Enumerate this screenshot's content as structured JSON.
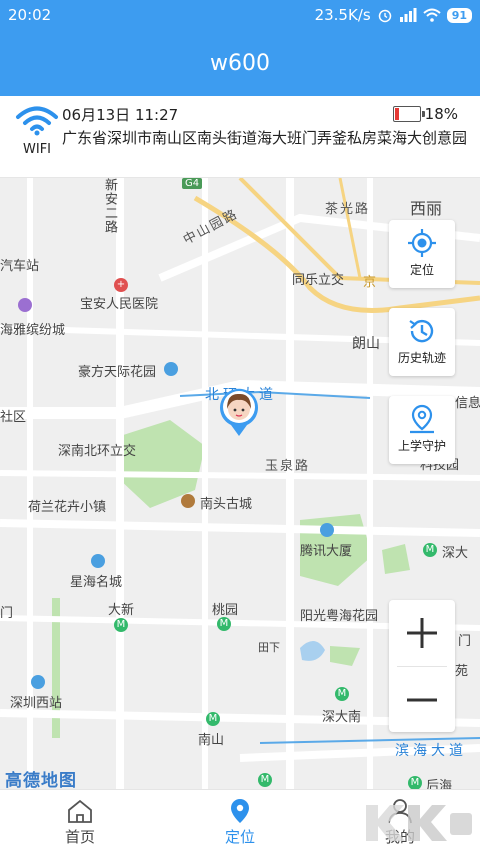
{
  "status_bar": {
    "time": "20:02",
    "net_speed": "23.5K/s",
    "battery_level": "91"
  },
  "header": {
    "title": "w600"
  },
  "device_info": {
    "connection_label": "WIFI",
    "timestamp": "06月13日 11:27",
    "battery_percent": "18%",
    "battery_fraction": 0.18,
    "address": "广东省深圳市南山区南头街道海大班门弄釜私房菜海大创意园"
  },
  "map": {
    "labels": {
      "xin_an_road": "新安二路",
      "car_station": "汽车站",
      "baoan_hospital": "宝安人民医院",
      "yafang": "海雅缤纷城",
      "haofang": "豪方天际花园",
      "she_qu": "社区",
      "shennan_beihuan": "深南北环立交",
      "helan": "荷兰花卉小镇",
      "xinghai": "星海名城",
      "men1": "门",
      "daxin": "大新",
      "shenzhen_west": "深圳西站",
      "zhongshan_park_road": "中山园路",
      "tongle": "同乐立交",
      "chaguang": "茶光路",
      "xili": "西丽",
      "g4": "G4",
      "langshan": "朗山",
      "beihuan": "北环大道",
      "yuquan": "玉泉路",
      "nantou": "南头古城",
      "tengxun": "腾讯大厦",
      "taoyuan": "桃园",
      "yangguang": "阳光粤海花园",
      "tianxia": "田下",
      "shenda": "深大",
      "shendanan": "深大南",
      "nanshan": "南山",
      "binhai": "滨海大道",
      "houhai": "后海",
      "men2": "门",
      "yuan": "苑",
      "xinxi": "信息",
      "keji": "科技园",
      "jing": "京"
    },
    "logo_text": "高德地图"
  },
  "side_buttons": {
    "locate": "定位",
    "history": "历史轨迹",
    "school_guard": "上学守护"
  },
  "bottom_nav": {
    "home": "首页",
    "locate": "定位",
    "mine": "我的"
  },
  "colors": {
    "primary": "#3d9cf0",
    "active_tab": "#2d91ec",
    "battery_low": "#e53935"
  }
}
